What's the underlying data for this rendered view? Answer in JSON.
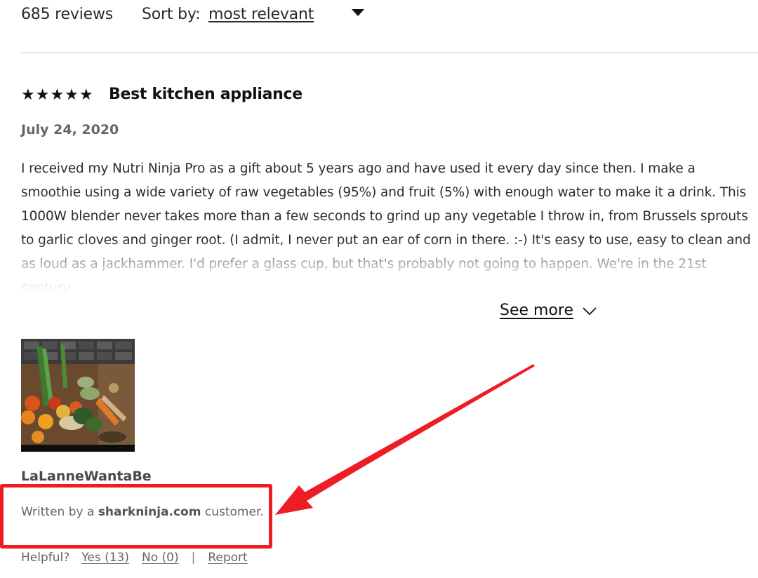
{
  "header": {
    "review_count": "685 reviews",
    "sort_label": "Sort by:",
    "sort_value": "most relevant"
  },
  "review": {
    "rating": 5,
    "stars": "★★★★★",
    "title": "Best kitchen appliance",
    "date": "July 24, 2020",
    "body": "I received my Nutri Ninja Pro as a gift about 5 years ago and have used it every day since then. I make a smoothie using a wide variety of raw vegetables (95%) and fruit (5%) with enough water to make it a drink. This 1000W blender never takes more than a few seconds to grind up any vegetable I throw in, from Brussels sprouts to garlic cloves and ginger root. (I admit, I never put an ear of corn in there. :-) It's easy to use, easy to clean and as loud as a jackhammer. I'd prefer a glass cup, but that's probably not going to happen. We're in the 21st century.",
    "see_more_label": "See more",
    "reviewer_name": "LaLanneWantaBe",
    "source_prefix": "Written by a",
    "source_domain": "sharkninja.com",
    "source_suffix": "customer."
  },
  "helpful": {
    "label": "Helpful?",
    "yes_label": "Yes (13)",
    "no_label": "No (0)",
    "separator": "|",
    "report_label": "Report"
  },
  "annotation": {
    "box_color": "#ee1c24",
    "arrow_color": "#ee1c24"
  },
  "icons": {
    "sort": "caret-down-icon",
    "see_more": "chevron-down-icon"
  }
}
